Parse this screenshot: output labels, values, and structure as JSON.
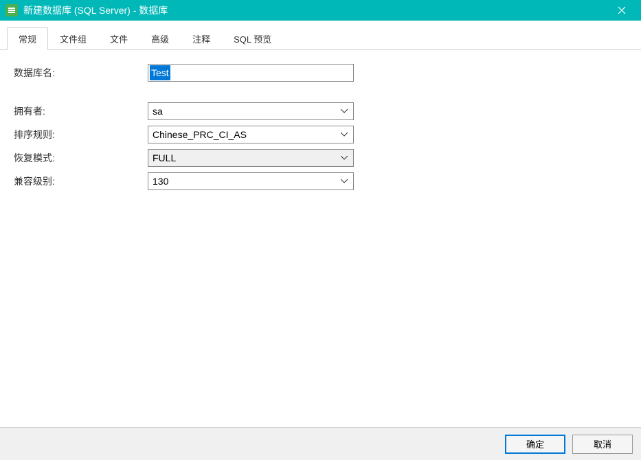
{
  "titlebar": {
    "title": "新建数据库 (SQL Server) - 数据库"
  },
  "tabs": {
    "items": [
      {
        "label": "常规",
        "active": true
      },
      {
        "label": "文件组",
        "active": false
      },
      {
        "label": "文件",
        "active": false
      },
      {
        "label": "高级",
        "active": false
      },
      {
        "label": "注释",
        "active": false
      },
      {
        "label": "SQL 预览",
        "active": false
      }
    ]
  },
  "form": {
    "database_name_label": "数据库名:",
    "database_name_value": "Test",
    "owner_label": "拥有者:",
    "owner_value": "sa",
    "collation_label": "排序规则:",
    "collation_value": "Chinese_PRC_CI_AS",
    "recovery_model_label": "恢复模式:",
    "recovery_model_value": "FULL",
    "compatibility_level_label": "兼容级别:",
    "compatibility_level_value": "130"
  },
  "footer": {
    "ok_label": "确定",
    "cancel_label": "取消"
  }
}
